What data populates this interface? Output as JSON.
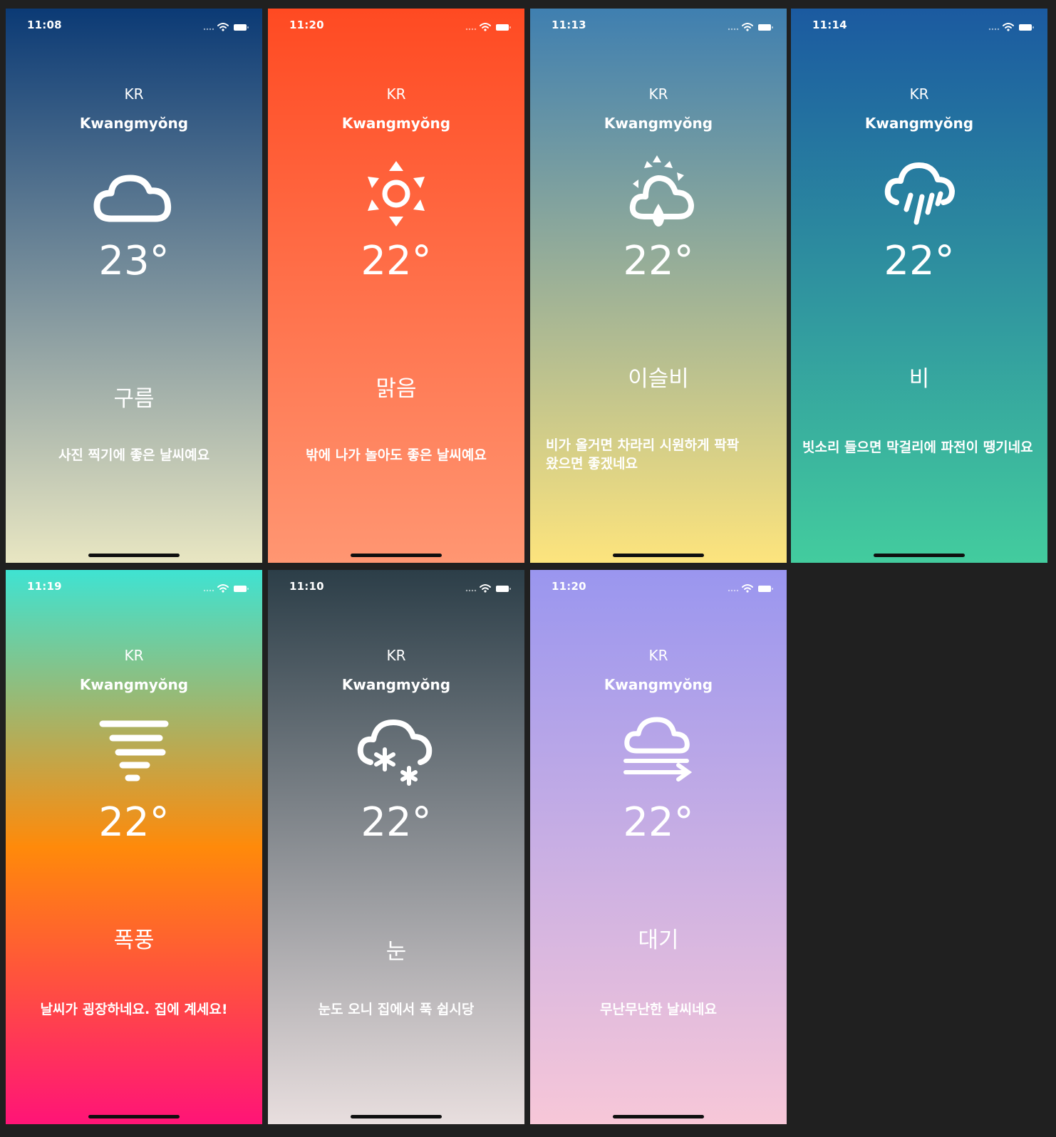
{
  "phones": [
    {
      "time": "11:08",
      "country": "KR",
      "city": "Kwangmyŏng",
      "icon": "cloud-icon",
      "temperature": "23°",
      "condition": "구름",
      "message": "사진 찍기에 좋은 날씨예요",
      "gradient": [
        "#0b3a75",
        "#e8e6c2"
      ]
    },
    {
      "time": "11:20",
      "country": "KR",
      "city": "Kwangmyŏng",
      "icon": "sun-icon",
      "temperature": "22°",
      "condition": "맑음",
      "message": "밖에 나가 놀아도 좋은 날씨예요",
      "gradient": [
        "#ff4a22",
        "#ff9672"
      ]
    },
    {
      "time": "11:13",
      "country": "KR",
      "city": "Kwangmyŏng",
      "icon": "drizzle-sun-icon",
      "temperature": "22°",
      "condition": "이슬비",
      "message": "비가 올거면 차라리 시원하게 팍팍 왔으면 좋겠네요",
      "gradient": [
        "#3f7fb0",
        "#fde47d"
      ]
    },
    {
      "time": "11:14",
      "country": "KR",
      "city": "Kwangmyŏng",
      "icon": "rain-icon",
      "temperature": "22°",
      "condition": "비",
      "message": "빗소리 들으면 막걸리에 파전이 땡기네요",
      "gradient": [
        "#1b5aa0",
        "#43cc9e"
      ]
    },
    {
      "time": "11:19",
      "country": "KR",
      "city": "Kwangmyŏng",
      "icon": "tornado-icon",
      "temperature": "22°",
      "condition": "폭풍",
      "message": "날씨가 굉장하네요. 집에 계세요!",
      "gradient": [
        "#3fe3d2",
        "#ff8a0a",
        "#ff1477"
      ]
    },
    {
      "time": "11:10",
      "country": "KR",
      "city": "Kwangmyŏng",
      "icon": "snow-icon",
      "temperature": "22°",
      "condition": "눈",
      "message": "눈도 오니 집에서 푹 쉽시당",
      "gradient": [
        "#2c3e48",
        "#e8dede"
      ]
    },
    {
      "time": "11:20",
      "country": "KR",
      "city": "Kwangmyŏng",
      "icon": "wind-icon",
      "temperature": "22°",
      "condition": "대기",
      "message": "무난무난한 날씨네요",
      "gradient": [
        "#9a96ef",
        "#f7c7d8"
      ]
    }
  ]
}
